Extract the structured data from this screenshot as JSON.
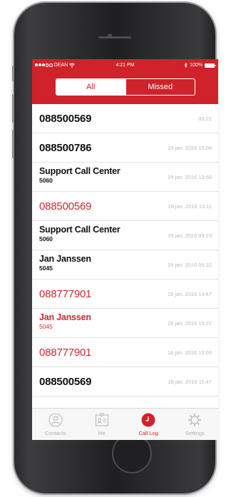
{
  "status_bar": {
    "carrier": "DEAN",
    "time": "4:21 PM",
    "battery": "100%",
    "wifi_icon": "wifi-icon",
    "bluetooth_icon": "bluetooth-icon"
  },
  "segmented_control": {
    "all_label": "All",
    "missed_label": "Missed"
  },
  "calls": [
    {
      "name": "088500569",
      "sub": "",
      "time": "09:21",
      "missed": false
    },
    {
      "name": "088500786",
      "sub": "",
      "time": "19 jan. 2016 15:09",
      "missed": false
    },
    {
      "name": "Support Call Center",
      "sub": "5060",
      "time": "19 jan. 2016 13:56",
      "missed": false
    },
    {
      "name": "088500569",
      "sub": "",
      "time": "19 jan. 2016 13:11",
      "missed": true
    },
    {
      "name": "Support Call Center",
      "sub": "5060",
      "time": "19 jan. 2016 09:23",
      "missed": false
    },
    {
      "name": "Jan Janssen",
      "sub": "5045",
      "time": "19 jan. 2016 09:22",
      "missed": false
    },
    {
      "name": "088777901",
      "sub": "",
      "time": "18 jan. 2016 14:47",
      "missed": true
    },
    {
      "name": "Jan Janssen",
      "sub": "5045",
      "time": "18 jan. 2016 13:21",
      "missed": true
    },
    {
      "name": "088777901",
      "sub": "",
      "time": "18 jan. 2016 12:00",
      "missed": true
    },
    {
      "name": "088500569",
      "sub": "",
      "time": "18 jan. 2016 11:47",
      "missed": false
    }
  ],
  "tab_bar": {
    "contacts": "Contacts",
    "me": "Me",
    "call_log": "Call Log",
    "settings": "Settings"
  },
  "colors": {
    "accent": "#d0222b",
    "missed": "#cf2830",
    "time_gray": "#b8b8b8"
  }
}
